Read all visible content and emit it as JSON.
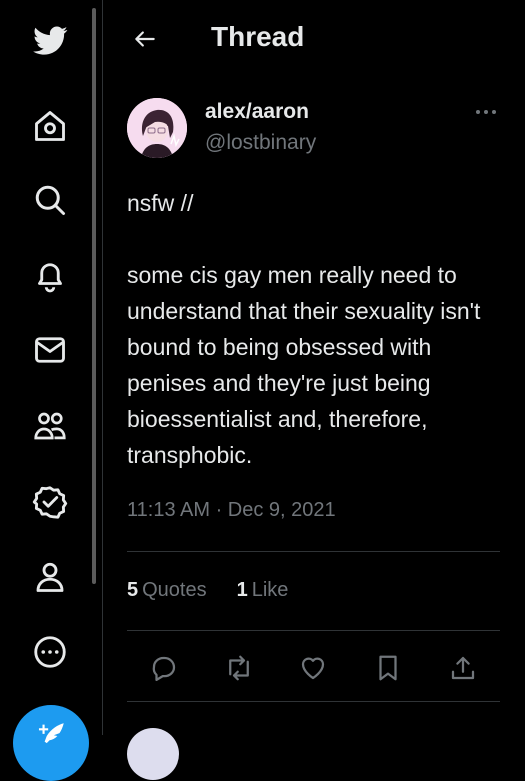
{
  "header": {
    "title": "Thread"
  },
  "sidebar": {
    "items": [
      "twitter-logo",
      "home",
      "explore",
      "notifications",
      "messages",
      "communities",
      "verified",
      "profile",
      "more"
    ]
  },
  "tweet": {
    "author_name": "alex/aaron",
    "author_handle": "@lostbinary",
    "text": "nsfw //\n\nsome cis gay men really need to understand that their sexuality isn't bound to being obsessed with penises and they're just being bioessentialist and, therefore, transphobic.",
    "timestamp": "11:13 AM · Dec 9, 2021",
    "quotes_count": "5",
    "quotes_label": "Quotes",
    "likes_count": "1",
    "likes_label": "Like"
  },
  "colors": {
    "accent": "#1d9bf0",
    "text": "#e7e9ea",
    "muted": "#71767b",
    "border": "#2f3336"
  }
}
